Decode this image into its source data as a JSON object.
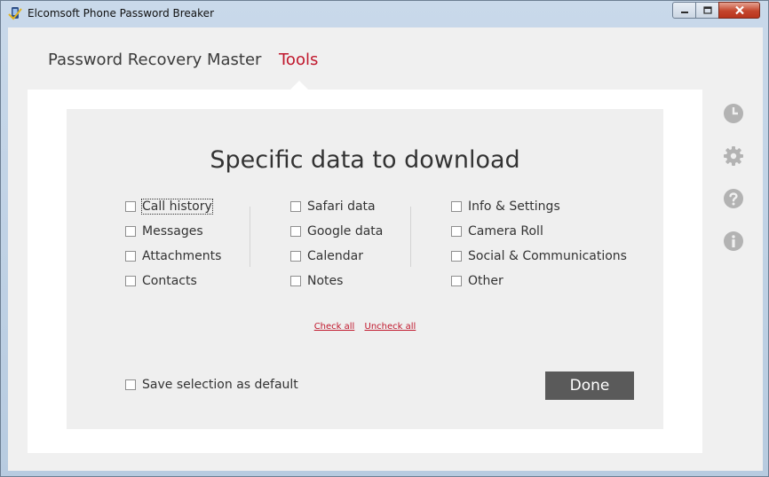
{
  "window": {
    "title": "Elcomsoft Phone Password Breaker",
    "accent_color": "#c0172c"
  },
  "tabs": [
    {
      "label": "Password Recovery Master",
      "active": false
    },
    {
      "label": "Tools",
      "active": true
    }
  ],
  "panel": {
    "title": "Specific data to download",
    "options": {
      "column1": [
        {
          "label": "Call history",
          "checked": false,
          "focused": true
        },
        {
          "label": "Messages",
          "checked": false
        },
        {
          "label": "Attachments",
          "checked": false
        },
        {
          "label": "Contacts",
          "checked": false
        }
      ],
      "column2": [
        {
          "label": "Safari data",
          "checked": false
        },
        {
          "label": "Google data",
          "checked": false
        },
        {
          "label": "Calendar",
          "checked": false
        },
        {
          "label": "Notes",
          "checked": false
        }
      ],
      "column3": [
        {
          "label": "Info & Settings",
          "checked": false
        },
        {
          "label": "Camera Roll",
          "checked": false
        },
        {
          "label": "Social & Communications",
          "checked": false
        },
        {
          "label": "Other",
          "checked": false
        }
      ]
    },
    "links": {
      "check_all": "Check all",
      "uncheck_all": "Uncheck all"
    },
    "save_default": {
      "label": "Save selection as default",
      "checked": false
    },
    "done_label": "Done"
  },
  "sidebar_icons": [
    "history-icon",
    "settings-gear-icon",
    "help-icon",
    "info-icon"
  ]
}
